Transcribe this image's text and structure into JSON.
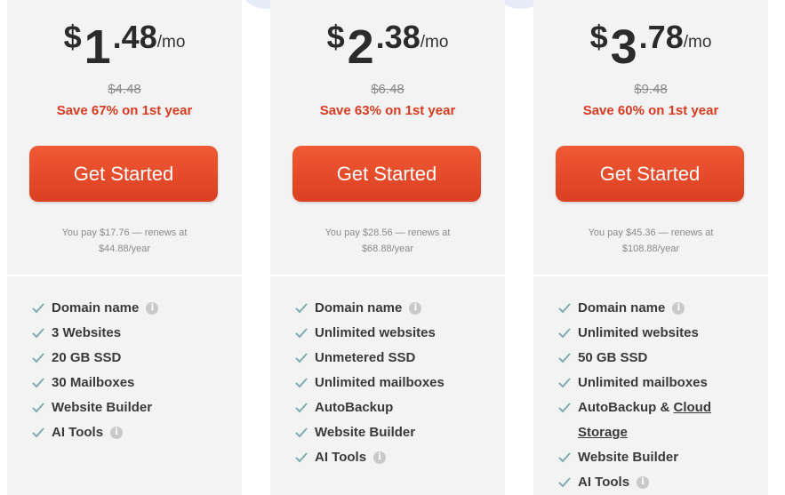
{
  "colors": {
    "accent": "#e4472a",
    "save_text": "#d93a1f",
    "check": "#7faab3",
    "card_bg": "#f3f3f3"
  },
  "plans": [
    {
      "price": {
        "currency": "$",
        "whole": "1",
        "cents": ".48",
        "period": "/mo"
      },
      "old_price": "$4.48",
      "save": "Save 67% on 1st year",
      "cta": "Get Started",
      "renew_line1": "You pay $17.76 — renews at",
      "renew_line2": "$44.88/year",
      "features": [
        {
          "label": "Domain name",
          "info": true
        },
        {
          "label": "3 Websites"
        },
        {
          "label": "20 GB SSD"
        },
        {
          "label": "30 Mailboxes"
        },
        {
          "label": "Website Builder"
        },
        {
          "label": "AI Tools",
          "info": true
        }
      ]
    },
    {
      "price": {
        "currency": "$",
        "whole": "2",
        "cents": ".38",
        "period": "/mo"
      },
      "old_price": "$6.48",
      "save": "Save 63% on 1st year",
      "cta": "Get Started",
      "renew_line1": "You pay $28.56 — renews at",
      "renew_line2": "$68.88/year",
      "features": [
        {
          "label": "Domain name",
          "info": true
        },
        {
          "label": "Unlimited websites"
        },
        {
          "label": "Unmetered SSD"
        },
        {
          "label": "Unlimited mailboxes"
        },
        {
          "label": "AutoBackup"
        },
        {
          "label": "Website Builder"
        },
        {
          "label": "AI Tools",
          "info": true
        }
      ]
    },
    {
      "price": {
        "currency": "$",
        "whole": "3",
        "cents": ".78",
        "period": "/mo"
      },
      "old_price": "$9.48",
      "save": "Save 60% on 1st year",
      "cta": "Get Started",
      "renew_line1": "You pay $45.36 — renews at",
      "renew_line2": "$108.88/year",
      "features": [
        {
          "label": "Domain name",
          "info": true
        },
        {
          "label": "Unlimited websites"
        },
        {
          "label": "50 GB SSD"
        },
        {
          "label": "Unlimited mailboxes"
        },
        {
          "label": "AutoBackup & ",
          "link_line1": "Cloud",
          "link_line2": "Storage"
        },
        {
          "label": "Website Builder"
        },
        {
          "label": "AI Tools",
          "info": true
        }
      ]
    }
  ],
  "icons": {
    "check": "check-icon",
    "info": "info-icon"
  },
  "info_glyph": "i"
}
